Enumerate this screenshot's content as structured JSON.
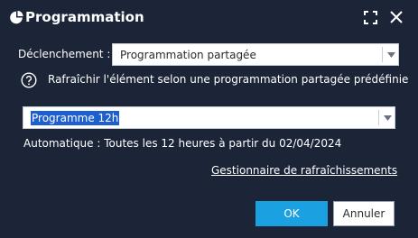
{
  "dialog": {
    "title": "Programmation",
    "icons": [
      "app-icon",
      "expand-icon",
      "close-icon"
    ]
  },
  "trigger": {
    "label": "Déclenchement :",
    "value": "Programmation partagée"
  },
  "help": {
    "icon": "question-circle-icon",
    "text": "Rafraîchir l'élément selon une programmation partagée prédéfinie"
  },
  "schedule": {
    "value": "Programme 12h"
  },
  "auto_text": "Automatique : Toutes les 12 heures à partir du 02/04/2024",
  "manager_link": "Gestionnaire de rafraîchissements",
  "buttons": {
    "ok": "OK",
    "cancel": "Annuler"
  },
  "colors": {
    "background": "#1c2538",
    "primary": "#1ba1e2",
    "selection": "#1e5fcf"
  }
}
